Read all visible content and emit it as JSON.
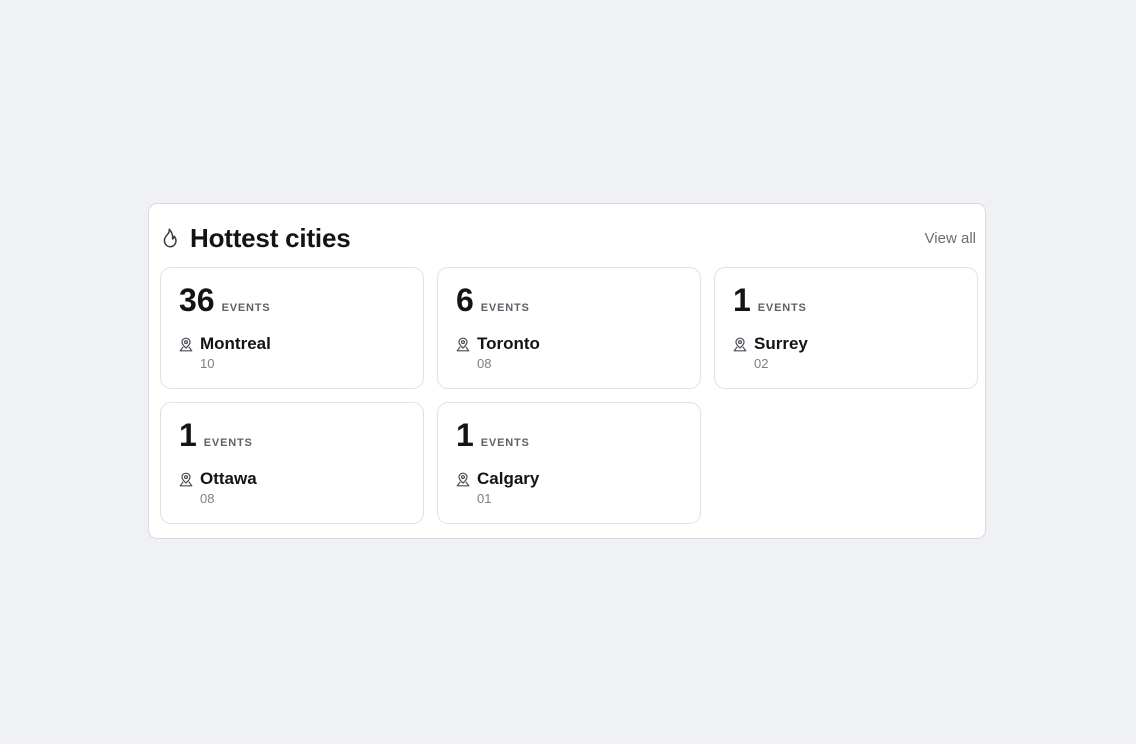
{
  "header": {
    "title": "Hottest cities",
    "title_icon": "flame-icon",
    "view_all_label": "View all"
  },
  "cities": [
    {
      "count": "36",
      "events_label": "EVENTS",
      "name": "Montreal",
      "code": "10"
    },
    {
      "count": "6",
      "events_label": "EVENTS",
      "name": "Toronto",
      "code": "08"
    },
    {
      "count": "1",
      "events_label": "EVENTS",
      "name": "Surrey",
      "code": "02"
    },
    {
      "count": "1",
      "events_label": "EVENTS",
      "name": "Ottawa",
      "code": "08"
    },
    {
      "count": "1",
      "events_label": "EVENTS",
      "name": "Calgary",
      "code": "01"
    }
  ],
  "city_icon": "map-pin-icon",
  "colors": {
    "background": "#f0f1f5",
    "panel": "#ffffff",
    "border": "#dfe1e6",
    "text_primary": "#141414",
    "text_muted": "#7b7e85"
  }
}
